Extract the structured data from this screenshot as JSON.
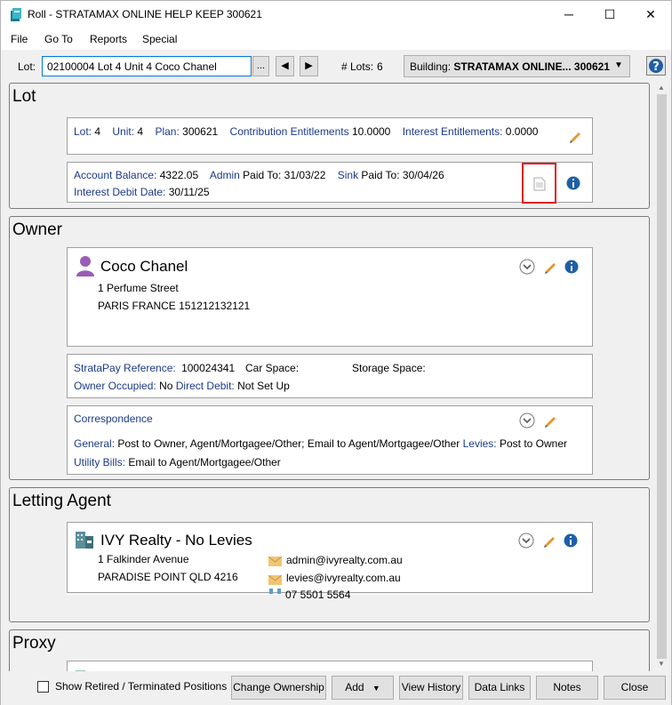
{
  "window": {
    "title": "Roll - STRATAMAX ONLINE HELP KEEP 300621",
    "minimize": "─",
    "maximize": "☐",
    "close": "✕"
  },
  "menu": {
    "items": [
      "File",
      "Go To",
      "Reports",
      "Special"
    ]
  },
  "toolbar": {
    "lot_label": "Lot:",
    "lot_value": "02100004  Lot 4   Unit 4   Coco Chanel",
    "ellipsis": "...",
    "prev": "◀",
    "next": "▶",
    "lots_label": "# Lots:",
    "lots_count": "6",
    "building_label": "Building:",
    "building_value": "STRATAMAX ONLINE...  300621",
    "building_arrow": "▼",
    "help": "?"
  },
  "lot": {
    "title": "Lot",
    "lot_label": "Lot:",
    "lot_value": "4",
    "unit_label": "Unit:",
    "unit_value": "4",
    "plan_label": "Plan:",
    "plan_value": "300621",
    "ce_label": "Contribution Entitlements",
    "ce_value": "10.0000",
    "ie_label": "Interest Entitlements:",
    "ie_value": "0.0000",
    "ab_label": "Account Balance:",
    "ab_value": "4322.05",
    "admin_label": "Admin",
    "admin_paid": "Paid To:",
    "admin_value": "31/03/22",
    "sink_label": "Sink",
    "sink_paid": "Paid To:",
    "sink_value": "30/04/26",
    "idd_label": "Interest Debit Date:",
    "idd_value": "30/11/25"
  },
  "owner": {
    "title": "Owner",
    "name": "Coco Chanel",
    "address1": "1 Perfume Street",
    "address2": "PARIS FRANCE 151212132121",
    "sp_label": "StrataPay Reference:",
    "sp_value": "100024341",
    "car_label": "Car Space:",
    "storage_label": "Storage Space:",
    "oo_label": "Owner Occupied:",
    "oo_value": "No",
    "dd_label": "Direct Debit:",
    "dd_value": "Not Set Up",
    "corr_title": "Correspondence",
    "general_label": "General:",
    "general_value": "Post to Owner, Agent/Mortgagee/Other; Email to Agent/Mortgagee/Other",
    "levies_label": "Levies:",
    "levies_value": "Post to Owner",
    "utility_label": "Utility Bills:",
    "utility_value": "Email to Agent/Mortgagee/Other"
  },
  "agent": {
    "title": "Letting Agent",
    "name": "IVY Realty - No Levies",
    "address1": "1 Falkinder Avenue",
    "address2": "PARADISE POINT  QLD  4216",
    "email1": "admin@ivyrealty.com.au",
    "email2": "levies@ivyrealty.com.au",
    "phone": "07 5501 5564"
  },
  "proxy": {
    "title": "Proxy"
  },
  "bottom": {
    "show_retired": "Show Retired / Terminated Positions",
    "change_ownership": "Change Ownership",
    "add": "Add",
    "add_arrow": "▼",
    "view_history": "View History",
    "data_links": "Data Links",
    "notes": "Notes",
    "close": "Close"
  },
  "colors": {
    "label_blue": "#1c3a8a",
    "highlight_red": "#e0191f",
    "info_blue": "#1f5fa8",
    "pencil_orange": "#e6962a"
  }
}
